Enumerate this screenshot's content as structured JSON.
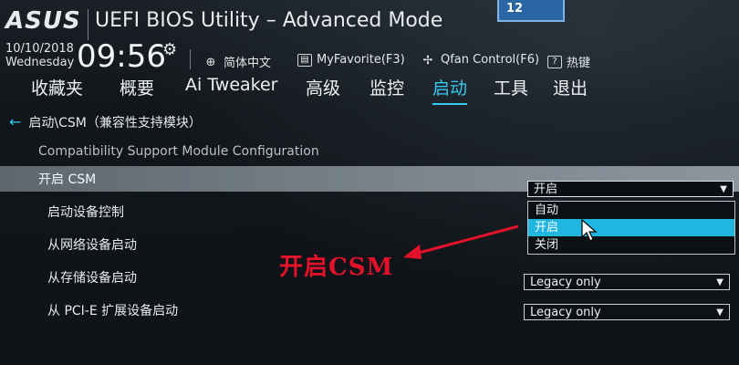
{
  "header": {
    "logo": "ASUS",
    "title": "UEFI BIOS Utility – Advanced Mode",
    "badge": "12"
  },
  "status": {
    "date": "10/10/2018",
    "day": "Wednesday",
    "time": "09:56",
    "language": "简体中文",
    "favorite": "MyFavorite(F3)",
    "qfan": "Qfan Control(F6)",
    "hotkeys": "热键"
  },
  "tabs": [
    {
      "label": "收藏夹"
    },
    {
      "label": "概要"
    },
    {
      "label": "Ai Tweaker"
    },
    {
      "label": "高级"
    },
    {
      "label": "监控"
    },
    {
      "label": "启动"
    },
    {
      "label": "工具"
    },
    {
      "label": "退出"
    }
  ],
  "breadcrumb": "启动\\CSM（兼容性支持模块）",
  "section_subtitle": "Compatibility Support Module Configuration",
  "rows": {
    "launch_csm": {
      "label": "开启 CSM",
      "value": "开启"
    },
    "boot_device_control": {
      "label": "启动设备控制"
    },
    "boot_from_network": {
      "label": "从网络设备启动"
    },
    "boot_from_storage": {
      "label": "从存储设备启动",
      "value": "Legacy only"
    },
    "boot_from_pcie": {
      "label": "从 PCI-E 扩展设备启动",
      "value": "Legacy only"
    }
  },
  "dropdown_options": [
    "自动",
    "开启",
    "关闭"
  ],
  "annotation": "开启CSM",
  "colors": {
    "accent": "#35c8f0",
    "highlight": "#1fb7df",
    "annotation": "#e3122a"
  }
}
